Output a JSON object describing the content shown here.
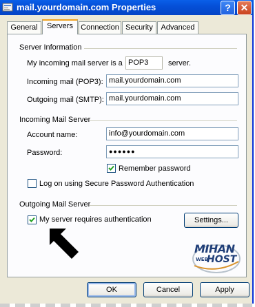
{
  "window": {
    "title": "mail.yourdomain.com Properties",
    "help_label": "?",
    "close_label": "✕"
  },
  "tabs": [
    {
      "label": "General",
      "active": false
    },
    {
      "label": "Servers",
      "active": true
    },
    {
      "label": "Connection",
      "active": false
    },
    {
      "label": "Security",
      "active": false
    },
    {
      "label": "Advanced",
      "active": false
    }
  ],
  "server_info": {
    "title": "Server Information",
    "incoming_prefix": "My incoming mail server is a",
    "server_type": "POP3",
    "incoming_suffix": "server.",
    "incoming_label": "Incoming mail (POP3):",
    "incoming_value": "mail.yourdomain.com",
    "outgoing_label": "Outgoing mail (SMTP):",
    "outgoing_value": "mail.yourdomain.com"
  },
  "incoming_server": {
    "title": "Incoming Mail Server",
    "account_label": "Account name:",
    "account_value": "info@yourdomain.com",
    "password_label": "Password:",
    "password_value": "●●●●●●",
    "remember_label": "Remember password",
    "remember_checked": true,
    "spa_label": "Log on using Secure Password Authentication",
    "spa_checked": false
  },
  "outgoing_server": {
    "title": "Outgoing Mail Server",
    "auth_label": "My server requires authentication",
    "auth_checked": true,
    "settings_label": "Settings..."
  },
  "logo": {
    "line1": "MIHAN",
    "line2a": "WEB",
    "line2b": "HOST"
  },
  "buttons": {
    "ok": "OK",
    "cancel": "Cancel",
    "apply": "Apply"
  },
  "colors": {
    "titlebar": "#0550d8",
    "tab_highlight": "#f0a21e",
    "dialog_bg": "#ece9d8",
    "checkmark": "#21a121"
  },
  "icons": {
    "window": "mail-account-icon",
    "arrow": "pointer-arrow-icon"
  }
}
